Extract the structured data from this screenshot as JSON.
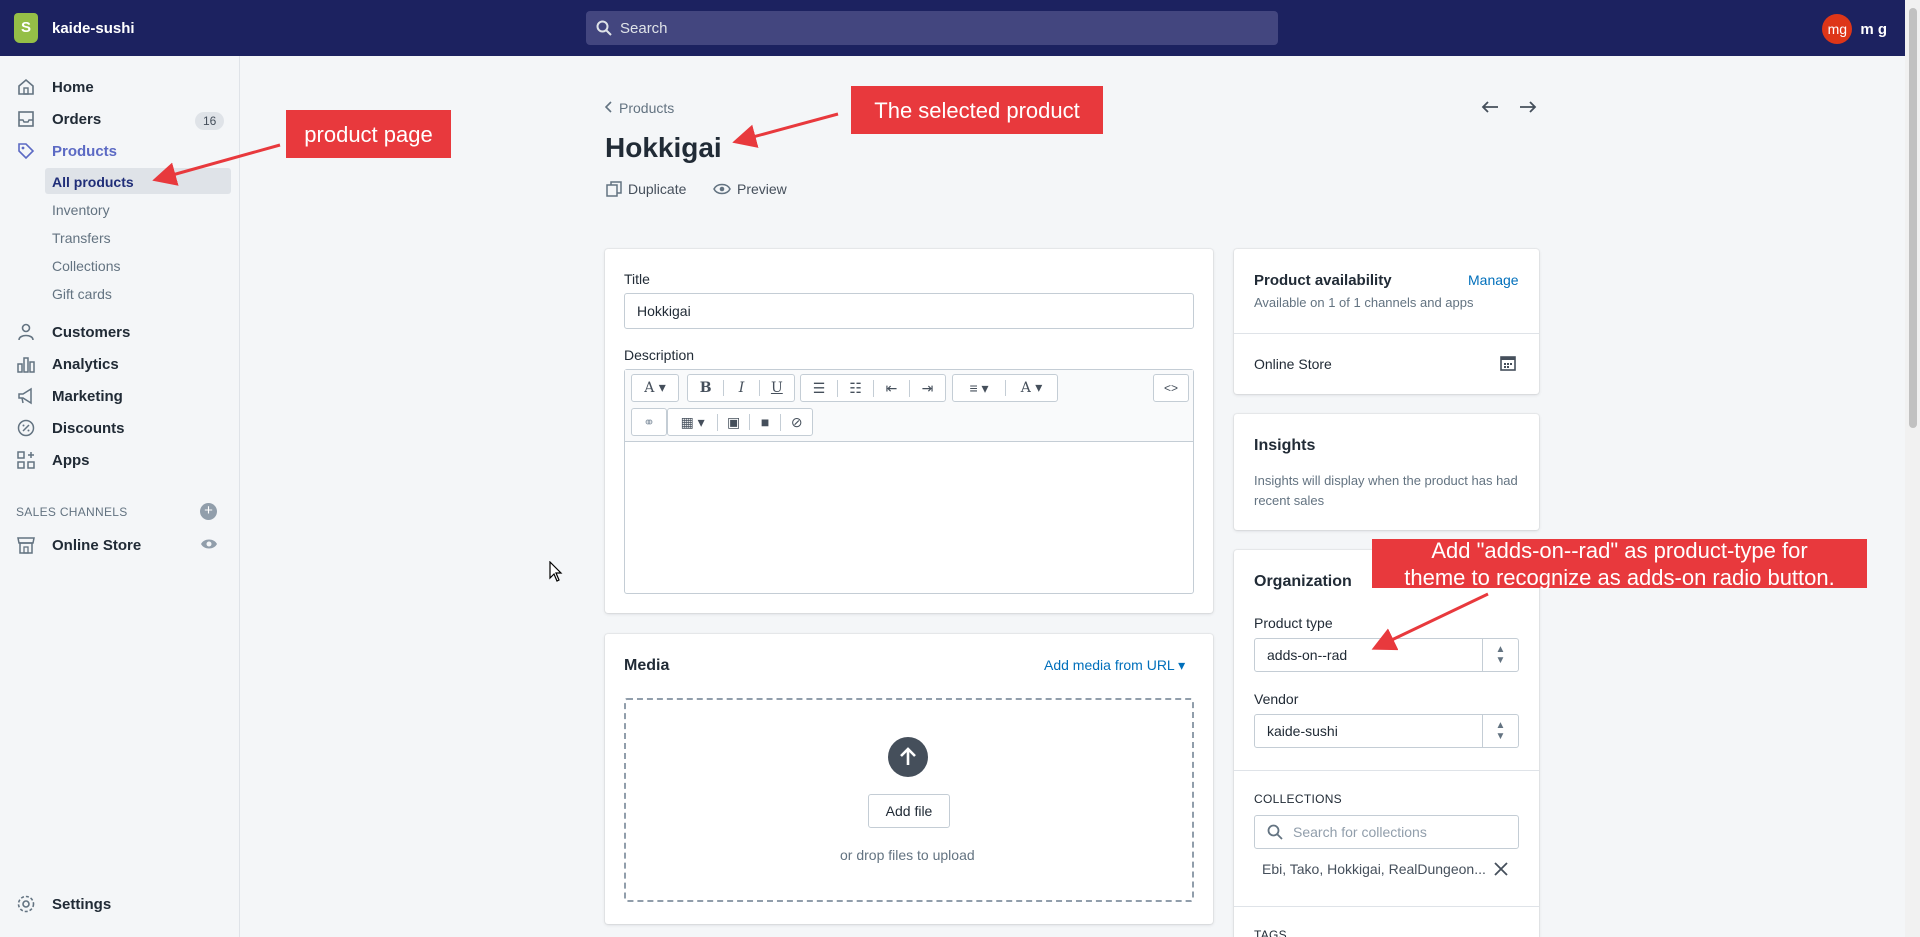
{
  "topbar": {
    "store_name": "kaide-sushi",
    "search_placeholder": "Search",
    "user_initials": "mg",
    "user_name": "m g"
  },
  "sidebar": {
    "items": [
      {
        "label": "Home",
        "icon": "home-icon"
      },
      {
        "label": "Orders",
        "icon": "orders-icon",
        "badge": "16"
      },
      {
        "label": "Products",
        "icon": "tag-icon"
      },
      {
        "label": "Customers",
        "icon": "person-icon"
      },
      {
        "label": "Analytics",
        "icon": "bar-chart-icon"
      },
      {
        "label": "Marketing",
        "icon": "megaphone-icon"
      },
      {
        "label": "Discounts",
        "icon": "discount-icon"
      },
      {
        "label": "Apps",
        "icon": "apps-icon"
      }
    ],
    "product_subitems": [
      "All products",
      "Inventory",
      "Transfers",
      "Collections",
      "Gift cards"
    ],
    "sales_channels_heading": "SALES CHANNELS",
    "online_store": "Online Store",
    "settings": "Settings"
  },
  "main": {
    "breadcrumb": "Products",
    "title": "Hokkigai",
    "actions": {
      "duplicate": "Duplicate",
      "preview": "Preview"
    },
    "title_field": {
      "label": "Title",
      "value": "Hokkigai"
    },
    "description_label": "Description",
    "media": {
      "title": "Media",
      "add_from_url": "Add media from URL",
      "add_file": "Add file",
      "drop_hint": "or drop files to upload"
    }
  },
  "right": {
    "availability": {
      "title": "Product availability",
      "manage": "Manage",
      "subtitle": "Available on 1 of 1 channels and apps",
      "channel": "Online Store"
    },
    "insights": {
      "title": "Insights",
      "text": "Insights will display when the product has had recent sales"
    },
    "organization": {
      "title": "Organization",
      "product_type_label": "Product type",
      "product_type_value": "adds-on--rad",
      "vendor_label": "Vendor",
      "vendor_value": "kaide-sushi",
      "collections_heading": "COLLECTIONS",
      "collections_placeholder": "Search for collections",
      "collections_value": "Ebi, Tako, Hokkigai, RealDungeon...",
      "tags_heading": "TAGS"
    }
  },
  "annotations": {
    "product_page": "product page",
    "selected_product": "The selected product",
    "product_type_note_line1": "Add \"adds-on--rad\" as product-type for",
    "product_type_note_line2": "theme to recognize as adds-on radio button."
  },
  "colors": {
    "topbar": "#1c2260",
    "callout": "#e8393d",
    "link": "#006fbb",
    "active_nav": "#202e78"
  }
}
